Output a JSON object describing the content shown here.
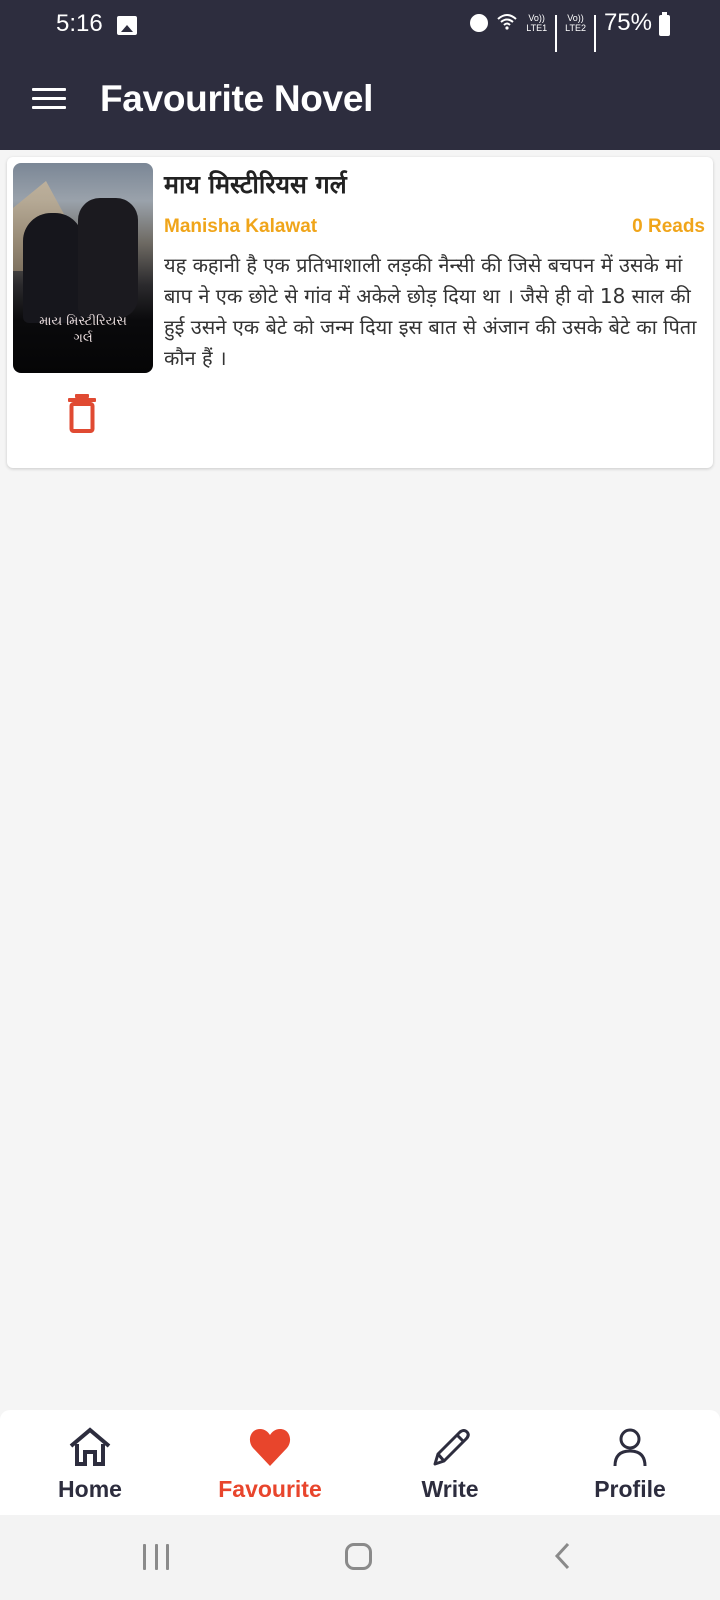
{
  "status_bar": {
    "time": "5:16",
    "icons": [
      "gallery-icon",
      "alarm-icon",
      "wifi-icon",
      "lte1-signal-icon",
      "lte2-signal-icon",
      "battery-icon"
    ],
    "lte1_label_top": "Vo))",
    "lte1_label_bottom": "LTE1",
    "lte2_label_top": "Vo))",
    "lte2_label_bottom": "LTE2",
    "battery_percent": "75%"
  },
  "app_bar": {
    "title": "Favourite Novel",
    "menu_icon": "hamburger-menu-icon"
  },
  "novels": [
    {
      "title": "माय मिस्टीरियस गर्ल",
      "author": "Manisha Kalawat",
      "reads": "0 Reads",
      "cover_title_line1": "માય મિસ્ટીરિયસ",
      "cover_title_line2": "ગર્લ",
      "description": "यह कहानी है एक  प्रतिभाशाली लड़की  नैन्सी की जिसे बचपन में उसके मां बाप ने एक छोटे से गांव में अकेले छोड़ दिया था । जैसे ही वो 18 साल की हुई उसने एक बेटे को जन्म दिया इस बात से अंजान की उसके बेटे का पिता कौन हैं ।",
      "delete_icon": "trash-icon"
    }
  ],
  "bottom_nav": {
    "items": [
      {
        "label": "Home",
        "icon": "home-icon",
        "active": false
      },
      {
        "label": "Favourite",
        "icon": "heart-icon",
        "active": true
      },
      {
        "label": "Write",
        "icon": "pencil-icon",
        "active": false
      },
      {
        "label": "Profile",
        "icon": "user-icon",
        "active": false
      }
    ]
  },
  "colors": {
    "app_bar_bg": "#2d2d3e",
    "accent_active": "#e8452c",
    "author_color": "#f0a51a",
    "page_bg": "#f5f5f5"
  }
}
